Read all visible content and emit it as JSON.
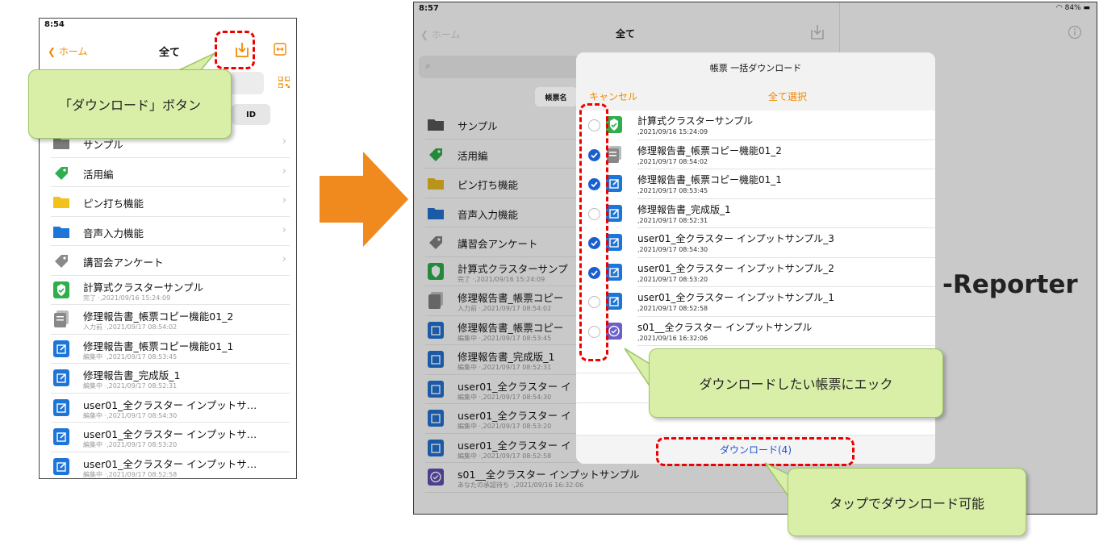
{
  "phone": {
    "time": "8:54",
    "back_label": "ホーム",
    "title": "全て",
    "id_segment": "ID",
    "folders": [
      {
        "label": "サンプル",
        "icon": "folder-gray-icon"
      },
      {
        "label": "活用編",
        "icon": "tag-green-icon"
      },
      {
        "label": "ピン打ち機能",
        "icon": "folder-yellow-icon"
      },
      {
        "label": "音声入力機能",
        "icon": "folder-blue-icon"
      },
      {
        "label": "講習会アンケート",
        "icon": "tag-gray-icon"
      }
    ],
    "documents": [
      {
        "title": "計算式クラスターサンプル",
        "sub": "完了 ·,2021/09/16 15:24:09",
        "icon": "check-badge-icon"
      },
      {
        "title": "修理報告書_帳票コピー機能01_2",
        "sub": "入力前 ·,2021/09/17 08:54:02",
        "icon": "copy-doc-icon"
      },
      {
        "title": "修理報告書_帳票コピー機能01_1",
        "sub": "編集中 ·,2021/09/17 08:53:45",
        "icon": "edit-doc-icon"
      },
      {
        "title": "修理報告書_完成版_1",
        "sub": "編集中 ·,2021/09/17 08:52:31",
        "icon": "edit-doc-icon"
      },
      {
        "title": "user01_全クラスター インプットサ…",
        "sub": "編集中 ·,2021/09/17 08:54:30",
        "icon": "edit-doc-icon"
      },
      {
        "title": "user01_全クラスター インプットサ…",
        "sub": "編集中 ·,2021/09/17 08:53:20",
        "icon": "edit-doc-icon"
      },
      {
        "title": "user01_全クラスター インプットサ…",
        "sub": "編集中 ·,2021/09/17 08:52:58",
        "icon": "edit-doc-icon"
      }
    ]
  },
  "callouts": {
    "download_button": "「ダウンロード」ボタン",
    "check_docs": "ダウンロードしたい帳票にエック",
    "tap_download": "タップでダウンロード可能"
  },
  "tablet": {
    "time": "8:57",
    "battery": "84%",
    "back_label": "ホーム",
    "title": "全て",
    "segment": "帳票名",
    "brand": "-Reporter",
    "folders": [
      {
        "label": "サンプル"
      },
      {
        "label": "活用編"
      },
      {
        "label": "ピン打ち機能"
      },
      {
        "label": "音声入力機能"
      },
      {
        "label": "講習会アンケート"
      }
    ],
    "documents": [
      {
        "title": "計算式クラスターサンプ",
        "sub": "完了 ·,2021/09/16 15:24:09"
      },
      {
        "title": "修理報告書_帳票コピー",
        "sub": "入力前 ·,2021/09/17 08:54:02"
      },
      {
        "title": "修理報告書_帳票コピー",
        "sub": "編集中 ·,2021/09/17 08:53:45"
      },
      {
        "title": "修理報告書_完成版_1",
        "sub": "編集中 ·,2021/09/17 08:52:31"
      },
      {
        "title": "user01_全クラスター イ",
        "sub": "編集中 ·,2021/09/17 08:54:30"
      },
      {
        "title": "user01_全クラスター イ",
        "sub": "編集中 ·,2021/09/17 08:53:20"
      },
      {
        "title": "user01_全クラスター イ",
        "sub": "編集中 ·,2021/09/17 08:52:58"
      },
      {
        "title": "s01__全クラスター インプットサンプル",
        "sub": "あなたの承認待ち ·,2021/09/16 16:32:06"
      }
    ]
  },
  "modal": {
    "title": "帳票 一括ダウンロード",
    "cancel": "キャンセル",
    "select_all": "全て選択",
    "download_button": "ダウンロード(4)",
    "items": [
      {
        "title": "計算式クラスターサンプル",
        "sub": ",2021/09/16 15:24:09",
        "checked": false,
        "icon": "check-badge-icon"
      },
      {
        "title": "修理報告書_帳票コピー機能01_2",
        "sub": ",2021/09/17 08:54:02",
        "checked": true,
        "icon": "copy-doc-icon"
      },
      {
        "title": "修理報告書_帳票コピー機能01_1",
        "sub": ",2021/09/17 08:53:45",
        "checked": true,
        "icon": "edit-doc-icon"
      },
      {
        "title": "修理報告書_完成版_1",
        "sub": ",2021/09/17 08:52:31",
        "checked": false,
        "icon": "edit-doc-icon"
      },
      {
        "title": "user01_全クラスター インプットサンプル_3",
        "sub": ",2021/09/17 08:54:30",
        "checked": true,
        "icon": "edit-doc-icon"
      },
      {
        "title": "user01_全クラスター インプットサンプル_2",
        "sub": ",2021/09/17 08:53:20",
        "checked": true,
        "icon": "edit-doc-icon"
      },
      {
        "title": "user01_全クラスター インプットサンプル_1",
        "sub": ",2021/09/17 08:52:58",
        "checked": false,
        "icon": "edit-doc-icon"
      },
      {
        "title": "s01__全クラスター インプットサンプル",
        "sub": ",2021/09/16 16:32:06",
        "checked": false,
        "icon": "approval-badge-icon"
      }
    ]
  },
  "colors": {
    "accent_orange": "#f08a00",
    "check_blue": "#1a5fd0",
    "callout_green": "#d9efa8",
    "dashed_red": "#e00000",
    "arrow_orange": "#f08a1e"
  }
}
